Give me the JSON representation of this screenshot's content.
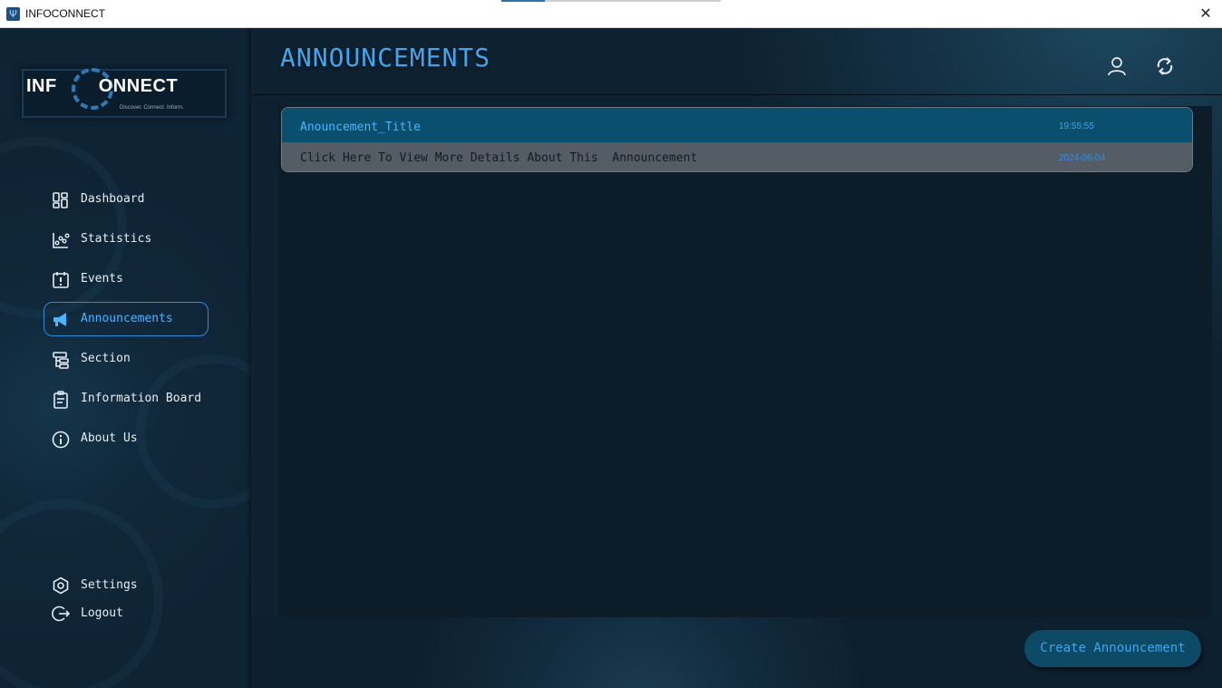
{
  "window": {
    "title": "INFOCONNECT",
    "close_glyph": "✕",
    "icon_glyph": "Ψ"
  },
  "logo": {
    "brand_left": "INF",
    "brand_right": "ONNECT",
    "tagline": "Discover. Connect. Inform."
  },
  "sidebar": {
    "items": [
      {
        "label": "Dashboard",
        "icon": "dashboard-icon"
      },
      {
        "label": "Statistics",
        "icon": "statistics-icon"
      },
      {
        "label": "Events",
        "icon": "events-icon"
      },
      {
        "label": "Announcements",
        "icon": "megaphone-icon",
        "active": true
      },
      {
        "label": "Section",
        "icon": "section-icon"
      },
      {
        "label": "Information Board",
        "icon": "clipboard-icon"
      },
      {
        "label": "About Us",
        "icon": "info-icon"
      }
    ],
    "bottom_items": [
      {
        "label": "Settings",
        "icon": "settings-icon"
      },
      {
        "label": "Logout",
        "icon": "logout-icon"
      }
    ]
  },
  "header": {
    "title": "ANNOUNCEMENTS",
    "user_icon": "user-icon",
    "refresh_icon": "refresh-icon"
  },
  "announcements": [
    {
      "title": "Anouncement_Title",
      "time": "19:55:55",
      "description": "Click Here To View More Details About This  Announcement",
      "date": "2024-06-04"
    }
  ],
  "actions": {
    "create_label": "Create Announcement"
  },
  "colors": {
    "accent": "#3fa7ef",
    "card_header": "#0b4f6e",
    "card_body": "#545d66",
    "sidebar_bg": "#0f2536"
  }
}
